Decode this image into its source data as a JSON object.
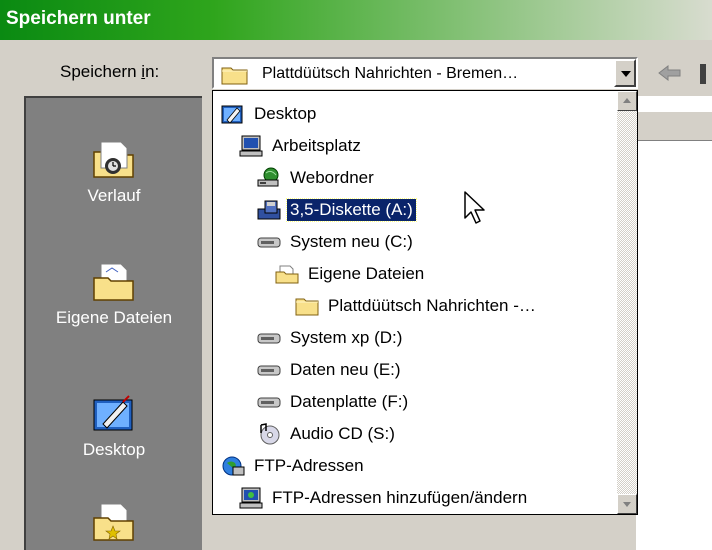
{
  "window": {
    "title": "Speichern unter"
  },
  "savein": {
    "label_pre": "Speichern ",
    "label_accel": "i",
    "label_post": "n:",
    "value": "Plattdüütsch Nahrichten - Bremen…",
    "icon": "folder-icon"
  },
  "places": [
    {
      "label": "Verlauf",
      "icon": "history-folder-icon"
    },
    {
      "label": "Eigene Dateien",
      "icon": "my-documents-folder-icon"
    },
    {
      "label": "Desktop",
      "icon": "desktop-icon"
    }
  ],
  "tree": [
    {
      "label": "Desktop",
      "icon": "desktop-icon"
    },
    {
      "label": "Arbeitsplatz",
      "icon": "my-computer-icon"
    },
    {
      "label": "Webordner",
      "icon": "web-folders-icon"
    },
    {
      "label": "3,5-Diskette (A:)",
      "icon": "floppy-drive-icon",
      "selected": true
    },
    {
      "label": "System neu (C:)",
      "icon": "hard-drive-icon"
    },
    {
      "label": "Eigene Dateien",
      "icon": "open-folder-icon"
    },
    {
      "label": "Plattdüütsch Nahrichten -…",
      "icon": "folder-icon"
    },
    {
      "label": "System xp (D:)",
      "icon": "hard-drive-icon"
    },
    {
      "label": "Daten neu (E:)",
      "icon": "hard-drive-icon"
    },
    {
      "label": "Datenplatte (F:)",
      "icon": "hard-drive-icon"
    },
    {
      "label": "Audio CD (S:)",
      "icon": "cd-drive-icon"
    },
    {
      "label": "FTP-Adressen",
      "icon": "ftp-globe-icon"
    },
    {
      "label": "FTP-Adressen hinzufügen/ändern",
      "icon": "ftp-computer-icon"
    }
  ],
  "colors": {
    "title_green": "#0a8a12",
    "selection": "#0a246a",
    "face": "#d4d0c8"
  }
}
